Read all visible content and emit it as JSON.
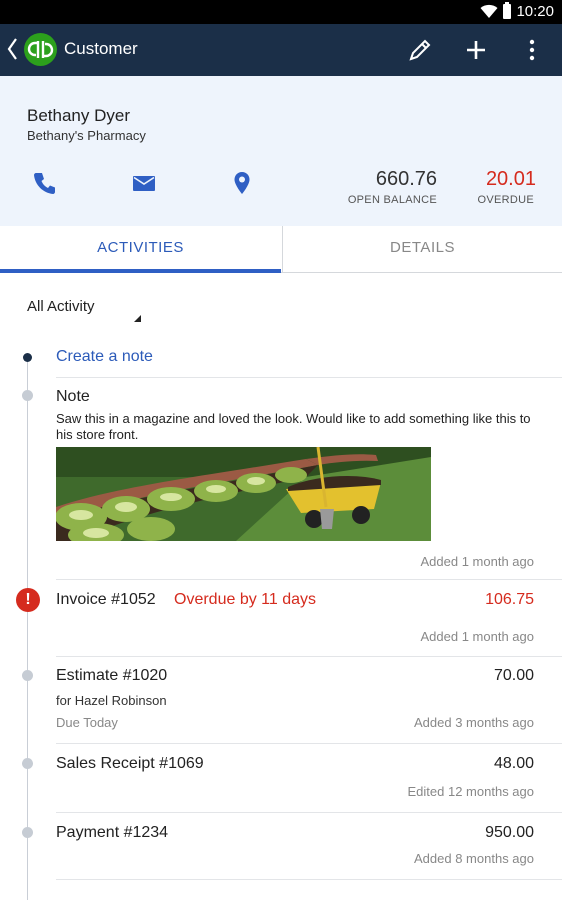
{
  "status_bar": {
    "time": "10:20"
  },
  "app_bar": {
    "title": "Customer"
  },
  "customer": {
    "name": "Bethany Dyer",
    "company": "Bethany's Pharmacy",
    "open_balance": "660.76",
    "open_balance_label": "OPEN BALANCE",
    "overdue": "20.01",
    "overdue_label": "OVERDUE"
  },
  "tabs": [
    {
      "label": "ACTIVITIES",
      "selected": true
    },
    {
      "label": "DETAILS",
      "selected": false
    }
  ],
  "filter": {
    "value": "All Activity"
  },
  "activities": {
    "create_note": "Create a note",
    "note": {
      "title": "Note",
      "body": "Saw this in a magazine and loved the look. Would like to add something like this to his store front.",
      "meta": "Added 1 month ago"
    },
    "invoice": {
      "title": "Invoice #1052",
      "status": "Overdue by 11 days",
      "amount": "106.75",
      "meta": "Added 1 month ago"
    },
    "estimate": {
      "title": "Estimate #1020",
      "sub": "for Hazel Robinson",
      "due": "Due Today",
      "amount": "70.00",
      "meta": "Added 3 months ago"
    },
    "sales_receipt": {
      "title": "Sales Receipt #1069",
      "amount": "48.00",
      "meta": "Edited 12 months ago"
    },
    "payment": {
      "title": "Payment #1234",
      "amount": "950.00",
      "meta": "Added 8 months ago"
    }
  },
  "colors": {
    "app_bar": "#1b2f48",
    "brand_green": "#2ca01c",
    "accent_blue": "#2c5bb9",
    "overdue_red": "#d52b1e"
  }
}
